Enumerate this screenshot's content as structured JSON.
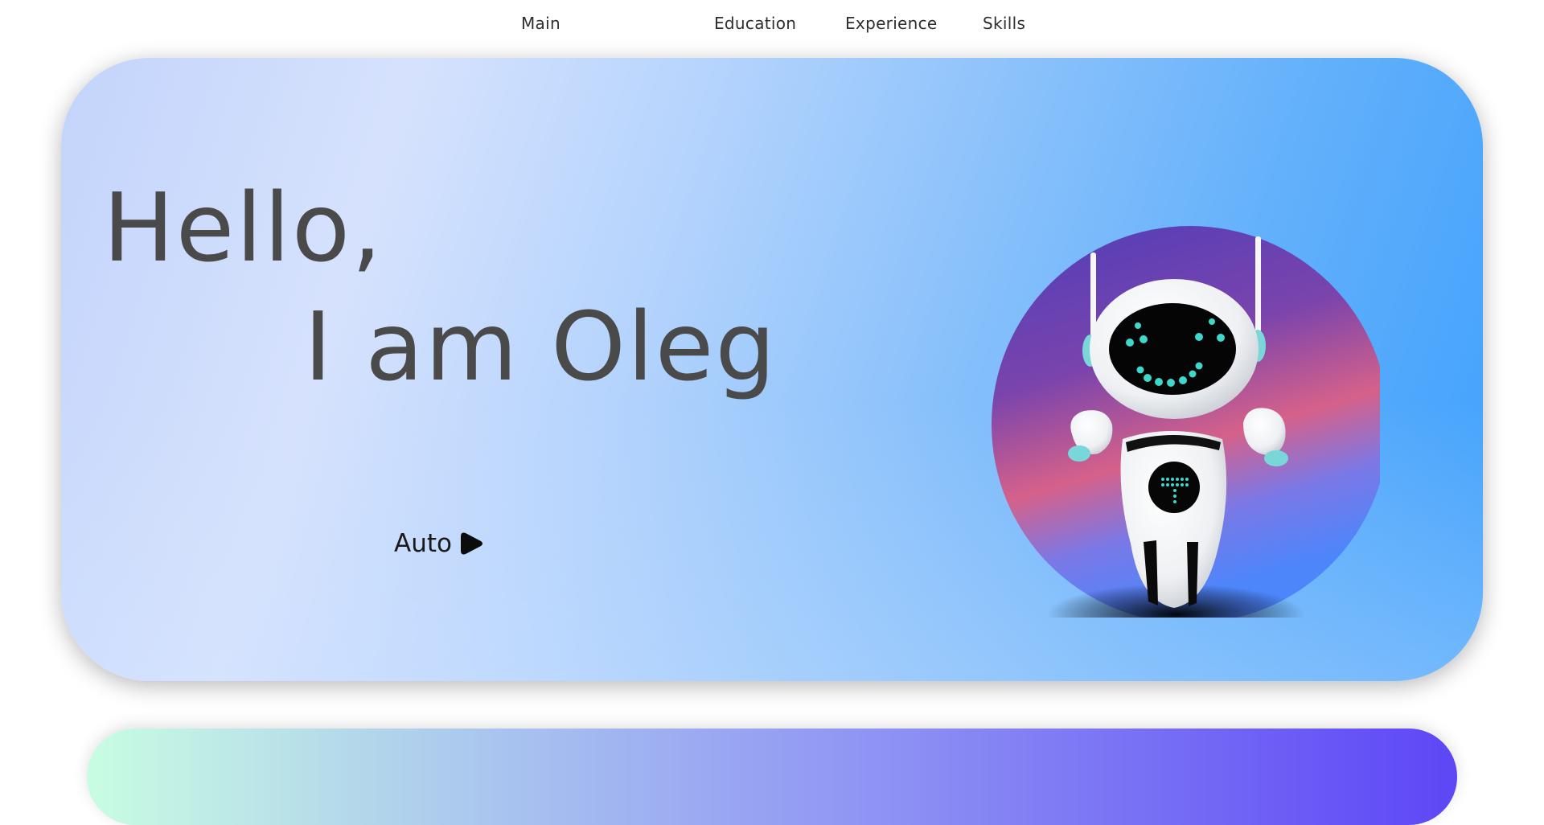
{
  "nav": {
    "items": [
      "Main",
      "Education",
      "Experience",
      "Skills"
    ]
  },
  "hero": {
    "greeting": "Hello,",
    "name_line": "I am Oleg",
    "auto_label": "Auto",
    "auto_icon": "play-icon",
    "robot_image": "robot-illustration"
  },
  "colors": {
    "hero_gradient_start": "#c3d4fb",
    "hero_gradient_end": "#3ea0fc",
    "text": "#4a4a4a",
    "circle_top": "#5a3fb6",
    "circle_mid": "#d5618a",
    "circle_bottom": "#4d86fb",
    "section2_start": "#c8fde2",
    "section2_end": "#5d46f6"
  }
}
